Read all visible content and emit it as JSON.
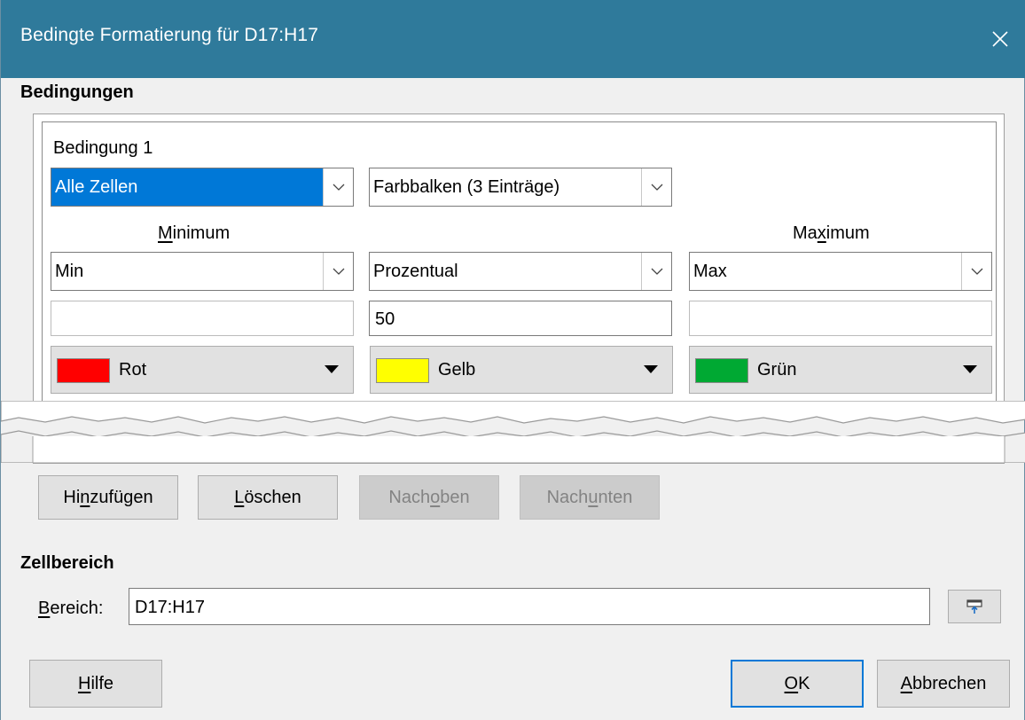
{
  "dialog": {
    "title": "Bedingte Formatierung für D17:H17",
    "close_icon": "close-icon"
  },
  "conditions": {
    "section_title": "Bedingungen",
    "condition1": {
      "label": "Bedingung 1",
      "applies_to": "Alle Zellen",
      "style": "Farbbalken (3 Einträge)",
      "minimum": {
        "label_pre": "",
        "label_ul": "M",
        "label_post": "inimum",
        "type": "Min",
        "value": "",
        "color_name": "Rot",
        "color_hex": "#ff0000"
      },
      "middle": {
        "type": "Prozentual",
        "value": "50",
        "color_name": "Gelb",
        "color_hex": "#ffff00"
      },
      "maximum": {
        "label_pre": "Ma",
        "label_ul": "x",
        "label_post": "imum",
        "type": "Max",
        "value": "",
        "color_name": "Grün",
        "color_hex": "#00a933"
      }
    }
  },
  "actions": {
    "add": {
      "pre": "Hi",
      "ul": "n",
      "post": "zufügen"
    },
    "delete": {
      "pre": "",
      "ul": "L",
      "post": "öschen"
    },
    "up": {
      "pre": "Nach ",
      "ul": "o",
      "post": "ben"
    },
    "down": {
      "pre": "Nach ",
      "ul": "u",
      "post": "nten"
    }
  },
  "cell_range": {
    "section_title": "Zellbereich",
    "label_ul": "B",
    "label_post": "ereich:",
    "value": "D17:H17",
    "shrink_icon": "shrink-range-icon"
  },
  "footer": {
    "help": {
      "ul": "H",
      "post": "ilfe"
    },
    "ok": {
      "ul": "O",
      "post": "K"
    },
    "cancel": {
      "ul": "A",
      "post": "bbrechen"
    }
  },
  "colors": {
    "titlebar": "#2f7a9b",
    "selection": "#0078d7"
  }
}
